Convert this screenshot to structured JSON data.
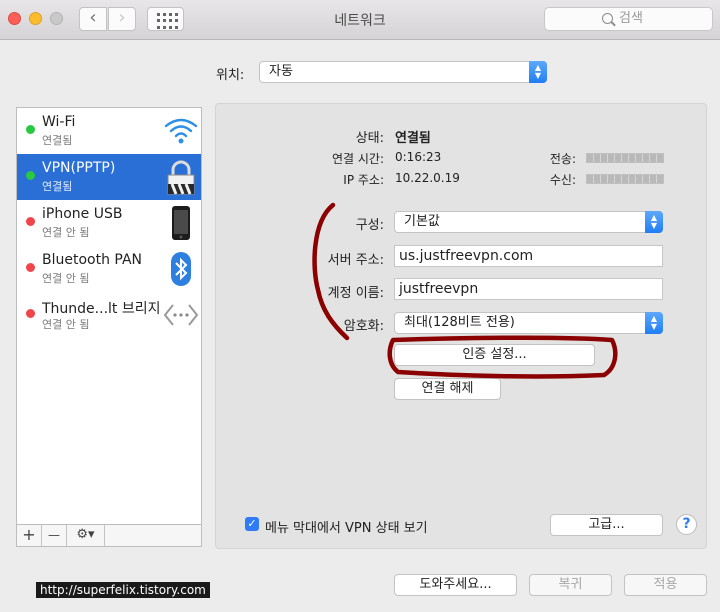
{
  "window": {
    "title": "네트워크"
  },
  "search": {
    "placeholder": "검색"
  },
  "location": {
    "label": "위치:",
    "value": "자동"
  },
  "sidebar": {
    "items": [
      {
        "name": "Wi-Fi",
        "status": "연결됨",
        "dot_color": "#28c840",
        "icon": "wifi-icon"
      },
      {
        "name": "VPN(PPTP)",
        "status": "연결됨",
        "dot_color": "#28c840",
        "icon": "lock-icon"
      },
      {
        "name": "iPhone USB",
        "status": "연결 안 됨",
        "dot_color": "#f0454b",
        "icon": "iphone-icon"
      },
      {
        "name": "Bluetooth PAN",
        "status": "연결 안 됨",
        "dot_color": "#f0454b",
        "icon": "bluetooth-icon"
      },
      {
        "name": "Thunde...lt 브리지",
        "status": "연결 안 됨",
        "dot_color": "#f0454b",
        "icon": "thunderbolt-bridge-icon"
      }
    ],
    "add_label": "+",
    "remove_label": "—"
  },
  "status": {
    "label": "상태:",
    "value": "연결됨",
    "time_label": "연결 시간:",
    "time_value": "0:16:23",
    "ip_label": "IP 주소:",
    "ip_value": "10.22.0.19",
    "sent_label": "전송:",
    "received_label": "수신:"
  },
  "config": {
    "config_label": "구성:",
    "config_value": "기본값",
    "server_label": "서버 주소:",
    "server_value": "us.justfreevpn.com",
    "account_label": "계정 이름:",
    "account_value": "justfreevpn",
    "encryption_label": "암호화:",
    "encryption_value": "최대(128비트 전용)",
    "auth_button": "인증 설정...",
    "disconnect_button": "연결 해제"
  },
  "footer": {
    "show_vpn_status_label": "메뉴 막대에서 VPN 상태 보기",
    "show_vpn_status_checked": true,
    "advanced_button": "고급...",
    "help_button": "?",
    "assist_button": "도와주세요...",
    "revert_button": "복귀",
    "apply_button": "적용"
  },
  "watermark": "http://superfelix.tistory.com",
  "colors": {
    "accent": "#2a6fd6",
    "annotation": "#8b0000",
    "connected": "#28c840",
    "disconnected": "#f0454b"
  }
}
